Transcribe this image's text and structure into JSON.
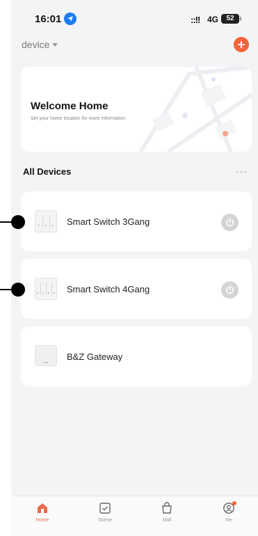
{
  "status_bar": {
    "time": "16:01",
    "signal": "::!!",
    "network": "4G",
    "battery": "52"
  },
  "header": {
    "home_selector": "device"
  },
  "welcome_card": {
    "title": "Welcome Home",
    "subtitle": "Set your home location for more information"
  },
  "devices_section": {
    "title": "All Devices",
    "more": "···"
  },
  "devices": [
    {
      "label": "Smart Switch 3Gang",
      "icon": "switch-3gang-icon",
      "has_power": true
    },
    {
      "label": "Smart Switch 4Gang",
      "icon": "switch-4gang-icon",
      "has_power": true
    },
    {
      "label": "B&Z Gateway",
      "icon": "gateway-icon",
      "has_power": false
    }
  ],
  "tabbar": {
    "items": [
      {
        "label": "Home",
        "icon": "home-icon",
        "active": true
      },
      {
        "label": "Scene",
        "icon": "scene-icon",
        "active": false
      },
      {
        "label": "Mall",
        "icon": "shopping-bag-icon",
        "active": false
      },
      {
        "label": "Me",
        "icon": "profile-icon",
        "active": false
      }
    ]
  },
  "colors": {
    "accent": "#f5633a",
    "active_tab": "#e86c4c",
    "background": "#f3f4f6",
    "card": "#ffffff",
    "power_button": "#d4d4d4"
  }
}
